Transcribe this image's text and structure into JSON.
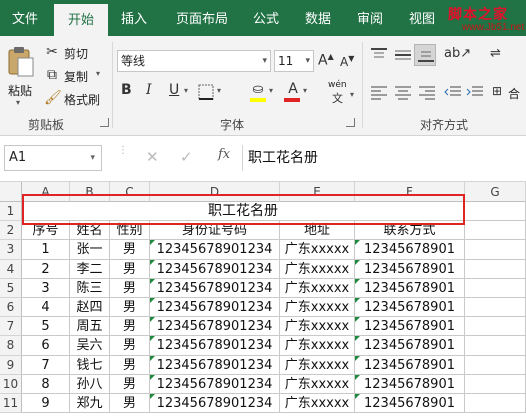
{
  "ribbon_tabs": [
    "文件",
    "开始",
    "插入",
    "页面布局",
    "公式",
    "数据",
    "审阅",
    "视图"
  ],
  "watermark": {
    "text": "脚本之家",
    "url": "www.Jb51.net"
  },
  "clipboard": {
    "paste_label": "粘贴",
    "cut_label": "剪切",
    "copy_label": "复制",
    "format_painter_label": "格式刷",
    "group_label": "剪贴板"
  },
  "font": {
    "family_value": "等线",
    "size_value": "11",
    "bold": "B",
    "italic": "I",
    "underline": "U",
    "phonetic": "wén",
    "group_label": "字体"
  },
  "alignment": {
    "group_label": "对齐方式",
    "merge_label": "合"
  },
  "formula_bar": {
    "name_box": "A1",
    "fx_label": "fx",
    "content": "职工花名册"
  },
  "columns": [
    "A",
    "B",
    "C",
    "D",
    "E",
    "F",
    "G"
  ],
  "rows": [
    "1",
    "2",
    "3",
    "4",
    "5",
    "6",
    "7",
    "8",
    "9",
    "10",
    "11"
  ],
  "sheet": {
    "title": "职工花名册",
    "headers": [
      "序号",
      "姓名",
      "性别",
      "身份证号码",
      "地址",
      "联系方式"
    ],
    "records": [
      [
        "1",
        "张一",
        "男",
        "12345678901234",
        "广东xxxxx",
        "12345678901"
      ],
      [
        "2",
        "李二",
        "男",
        "12345678901234",
        "广东xxxxx",
        "12345678901"
      ],
      [
        "3",
        "陈三",
        "男",
        "12345678901234",
        "广东xxxxx",
        "12345678901"
      ],
      [
        "4",
        "赵四",
        "男",
        "12345678901234",
        "广东xxxxx",
        "12345678901"
      ],
      [
        "5",
        "周五",
        "男",
        "12345678901234",
        "广东xxxxx",
        "12345678901"
      ],
      [
        "6",
        "吴六",
        "男",
        "12345678901234",
        "广东xxxxx",
        "12345678901"
      ],
      [
        "7",
        "钱七",
        "男",
        "12345678901234",
        "广东xxxxx",
        "12345678901"
      ],
      [
        "8",
        "孙八",
        "男",
        "12345678901234",
        "广东xxxxx",
        "12345678901"
      ],
      [
        "9",
        "郑九",
        "男",
        "12345678901234",
        "广东xxxxx",
        "12345678901"
      ]
    ]
  },
  "colors": {
    "accent": "#217346",
    "highlight_box": "#e02424",
    "fill_color": "#ffff00",
    "font_color": "#e02424"
  }
}
